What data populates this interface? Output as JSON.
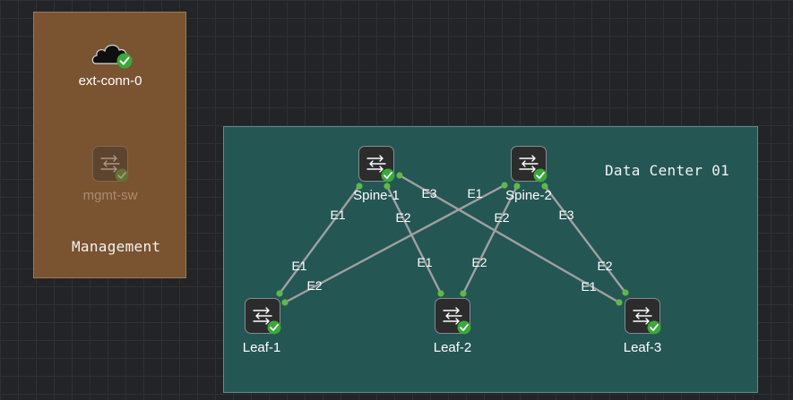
{
  "groups": {
    "management": {
      "label": "Management"
    },
    "datacenter": {
      "label": "Data Center 01"
    }
  },
  "nodes": {
    "ext_conn": {
      "label": "ext-conn-0",
      "icon": "cloud-icon",
      "status": "ok"
    },
    "mgmt_sw": {
      "label": "mgmt-sw",
      "icon": "switch-icon",
      "status": "ok",
      "dimmed": true
    },
    "spine1": {
      "label": "Spine-1",
      "icon": "switch-icon",
      "status": "ok"
    },
    "spine2": {
      "label": "Spine-2",
      "icon": "switch-icon",
      "status": "ok"
    },
    "leaf1": {
      "label": "Leaf-1",
      "icon": "switch-icon",
      "status": "ok"
    },
    "leaf2": {
      "label": "Leaf-2",
      "icon": "switch-icon",
      "status": "ok"
    },
    "leaf3": {
      "label": "Leaf-3",
      "icon": "switch-icon",
      "status": "ok"
    }
  },
  "links": [
    {
      "from": "spine1",
      "from_port": "E1",
      "to": "leaf1",
      "to_port": "E1"
    },
    {
      "from": "spine1",
      "from_port": "E2",
      "to": "leaf2",
      "to_port": "E1"
    },
    {
      "from": "spine1",
      "from_port": "E3",
      "to": "leaf3",
      "to_port": "E1"
    },
    {
      "from": "spine2",
      "from_port": "E1",
      "to": "leaf1",
      "to_port": "E2"
    },
    {
      "from": "spine2",
      "from_port": "E2",
      "to": "leaf2",
      "to_port": "E2"
    },
    {
      "from": "spine2",
      "from_port": "E3",
      "to": "leaf3",
      "to_port": "E2"
    }
  ],
  "colors": {
    "canvas": "#232427",
    "management_group": "#7a5330",
    "datacenter_group": "#245654",
    "link": "#a0a0a0",
    "port_dot": "#5fb84a",
    "status_ok": "#3aa83a"
  }
}
